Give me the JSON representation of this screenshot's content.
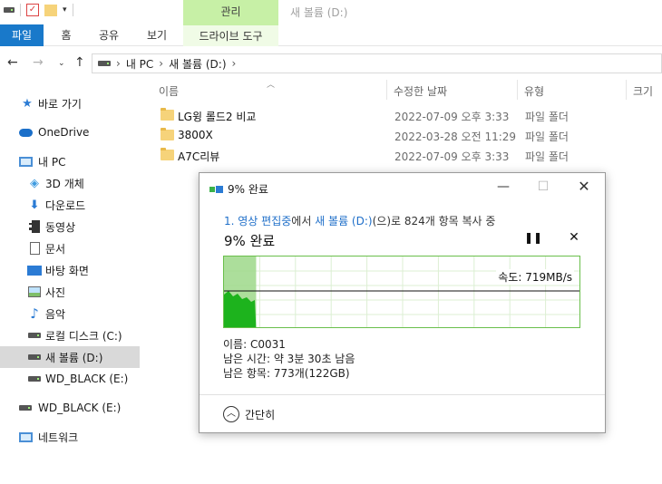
{
  "window": {
    "title": "새 볼륨 (D:)",
    "context_tab": "관리"
  },
  "ribbon": {
    "tabs": [
      "파일",
      "홈",
      "공유",
      "보기",
      "드라이브 도구"
    ]
  },
  "address": {
    "path": [
      "내 PC",
      "새 볼륨 (D:)"
    ]
  },
  "sidebar": {
    "items": [
      {
        "label": "바로 가기",
        "icon": "star-icon"
      },
      {
        "label": "OneDrive",
        "icon": "cloud-icon"
      },
      {
        "label": "내 PC",
        "icon": "pc-icon"
      },
      {
        "label": "3D 개체",
        "icon": "cube-icon"
      },
      {
        "label": "다운로드",
        "icon": "download-icon"
      },
      {
        "label": "동영상",
        "icon": "video-icon"
      },
      {
        "label": "문서",
        "icon": "document-icon"
      },
      {
        "label": "바탕 화면",
        "icon": "desktop-icon"
      },
      {
        "label": "사진",
        "icon": "picture-icon"
      },
      {
        "label": "음악",
        "icon": "music-icon"
      },
      {
        "label": "로컬 디스크 (C:)",
        "icon": "drive-icon"
      },
      {
        "label": "새 볼륨 (D:)",
        "icon": "drive-icon"
      },
      {
        "label": "WD_BLACK (E:)",
        "icon": "drive-icon"
      },
      {
        "label": "WD_BLACK (E:)",
        "icon": "drive-icon"
      },
      {
        "label": "네트워크",
        "icon": "network-icon"
      }
    ]
  },
  "filelist": {
    "columns": [
      "이름",
      "수정한 날짜",
      "유형",
      "크기"
    ],
    "rows": [
      {
        "name": "LG윙 롤드2 비교",
        "date": "2022-07-09 오후 3:33",
        "type": "파일 폴더"
      },
      {
        "name": "3800X",
        "date": "2022-03-28 오전 11:29",
        "type": "파일 폴더"
      },
      {
        "name": "A7C리뷰",
        "date": "2022-07-09 오후 3:33",
        "type": "파일 폴더"
      }
    ]
  },
  "dialog": {
    "title": "9% 완료",
    "info_prefix": "1. 영상 편집중",
    "info_mid": "에서 ",
    "info_dest": "새 볼륨 (D:)",
    "info_suffix": "(으)로 824개 항목 복사 중",
    "headline": "9% 완료",
    "speed": "속도: 719MB/s",
    "name_line": "이름: C0031",
    "time_line": "남은 시간: 약 3분 30초 남음",
    "items_line": "남은 항목: 773개(122GB)",
    "collapse_label": "간단히",
    "progress_percent": 9,
    "colors": {
      "progress": "#9ed88a",
      "throughput": "#1db31d",
      "accent": "#1f6fc9"
    }
  }
}
